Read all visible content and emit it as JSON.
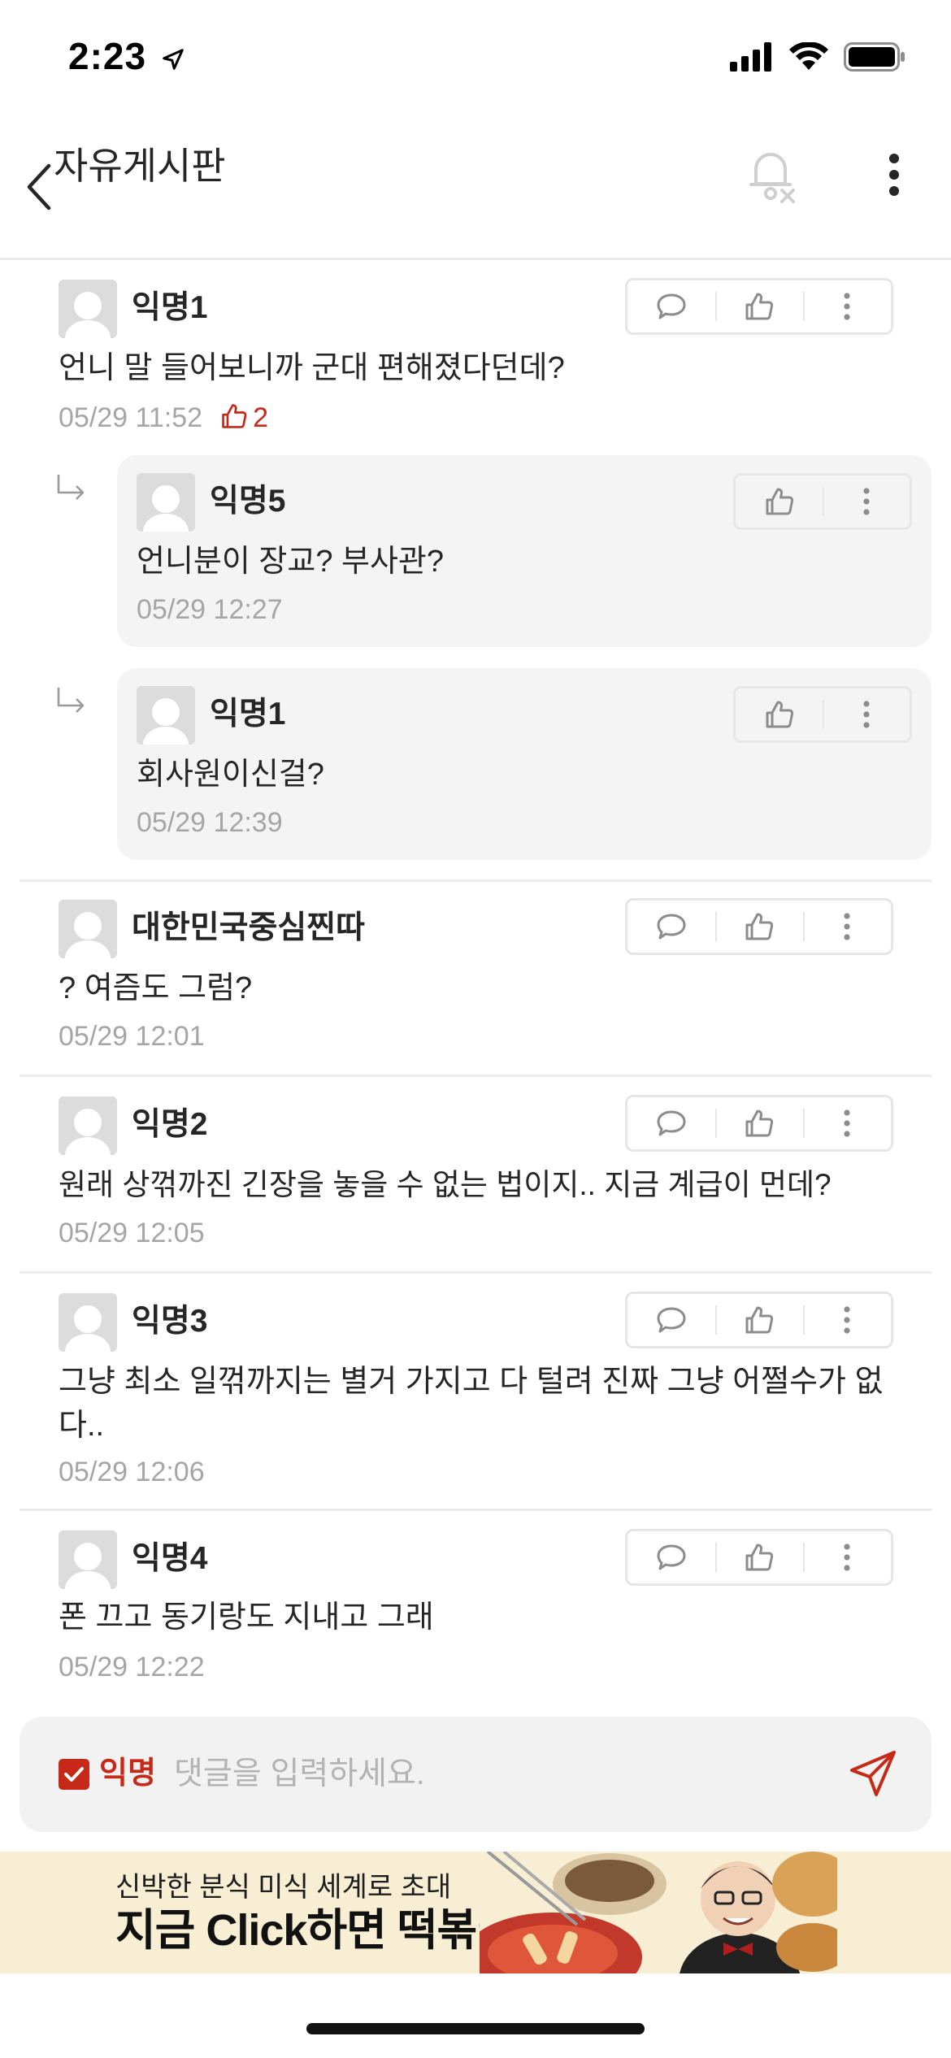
{
  "status_bar": {
    "time": "2:23"
  },
  "header": {
    "title": "자유게시판"
  },
  "comments": [
    {
      "author": "익명1",
      "text": "언니 말 들어보니까 군대 편해졌다던데?",
      "time": "05/29 11:52",
      "likes": "2"
    },
    {
      "author": "익명5",
      "text": "언니분이 장교? 부사관?",
      "time": "05/29 12:27"
    },
    {
      "author": "익명1",
      "text": "회사원이신걸?",
      "time": "05/29 12:39"
    },
    {
      "author": "대한민국중심찐따",
      "text": "? 여즘도 그럼?",
      "time": "05/29 12:01"
    },
    {
      "author": "익명2",
      "text": "원래 상꺾까진 긴장을 놓을 수 없는 법이지.. 지금 계급이 먼데?",
      "time": "05/29 12:05"
    },
    {
      "author": "익명3",
      "text": "그냥 최소 일꺾까지는 별거 가지고 다 털려 진짜 그냥 어쩔수가 없다..",
      "time": "05/29 12:06"
    },
    {
      "author": "익명4",
      "text": "폰 끄고 동기랑도 지내고 그래",
      "time": "05/29 12:22"
    }
  ],
  "comment_input": {
    "anonymous_label": "익명",
    "anonymous_checked": true,
    "placeholder": "댓글을 입력하세요."
  },
  "ad": {
    "line1": "신박한 분식 미식 세계로 초대",
    "line2": "지금 Click하면 떡볶이 GET"
  },
  "colors": {
    "accent": "#c62917",
    "meta": "#a6a6a6",
    "reply_bg": "#f4f4f4",
    "divider": "#ececec"
  }
}
